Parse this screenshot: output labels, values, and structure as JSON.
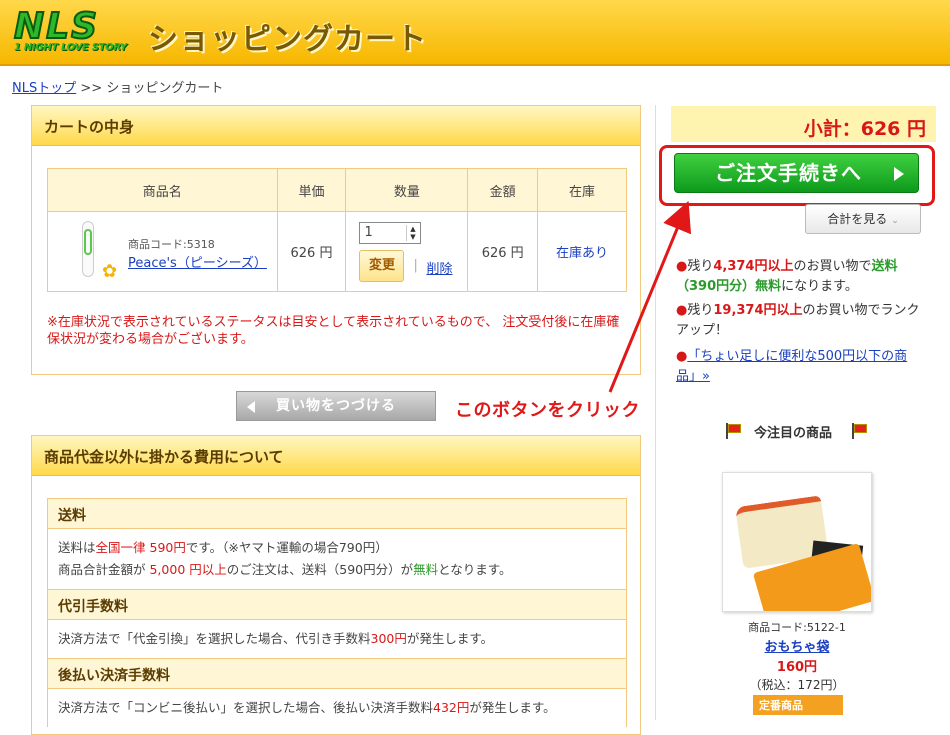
{
  "header": {
    "logo_big": "NLS",
    "logo_small": "1 NIGHT LOVE STORY",
    "page_heading": "ショッピングカート"
  },
  "breadcrumb": {
    "home_link": "NLSトップ",
    "separator": ">>",
    "current": "ショッピングカート"
  },
  "cart": {
    "title": "カートの中身",
    "columns": [
      "商品名",
      "単価",
      "数量",
      "金額",
      "在庫"
    ],
    "items": [
      {
        "code": "商品コード:5318",
        "name": "Peace's（ピーシーズ）",
        "unit_price": "626 円",
        "quantity": "1",
        "change_label": "変更",
        "delete_label": "削除",
        "amount": "626 円",
        "stock": "在庫あり"
      }
    ],
    "note": "※在庫状況で表示されているステータスは目安として表示されているもので、 注文受付後に在庫確保状況が変わる場合がございます。"
  },
  "continue_button": "買い物をつづける",
  "annotation": "このボタンをクリック",
  "fees": {
    "title": "商品代金以外に掛かる費用について",
    "sections": [
      {
        "title": "送料",
        "line1_a": "送料は",
        "line1_b": "全国一律 590円",
        "line1_c": "です。（※ヤマト運輸の場合790円）",
        "line2_a": "商品合計金額が ",
        "line2_b": "5,000 円以上",
        "line2_c": "のご注文は、送料（590円分）が",
        "line2_d": "無料",
        "line2_e": "となります。"
      },
      {
        "title": "代引手数料",
        "line1_a": "決済方法で「代金引換」を選択した場合、代引き手数料",
        "line1_b": "300円",
        "line1_c": "が発生します。"
      },
      {
        "title": "後払い決済手数料",
        "line1_a": "決済方法で「コンビニ後払い」を選択した場合、後払い決済手数料",
        "line1_b": "432円",
        "line1_c": "が発生します。"
      }
    ]
  },
  "sidebar": {
    "subtotal": "小計：626 円",
    "checkout_button": "ご注文手続きへ",
    "total_button": "合計を見る",
    "promo1_a": "残り",
    "promo1_b": "4,374円以上",
    "promo1_c": "のお買い物で",
    "promo1_d": "送料（390円分）無料",
    "promo1_e": "になります。",
    "promo2_a": "残り",
    "promo2_b": "19,374円以上",
    "promo2_c": "のお買い物でランクアップ！",
    "promo3_link": "「ちょい足しに便利な500円以下の商品」»",
    "attention_title": "今注目の商品",
    "featured": {
      "code": "商品コード:5122-1",
      "name": "おもちゃ袋",
      "price": "160円",
      "tax": "（税込：172円）",
      "badge": "定番商品"
    }
  },
  "colors": {
    "header_yellow": "#f7b700",
    "accent_red": "#d81818",
    "checkout_green": "#0d9a1c",
    "link_blue": "#1a3fc0"
  }
}
